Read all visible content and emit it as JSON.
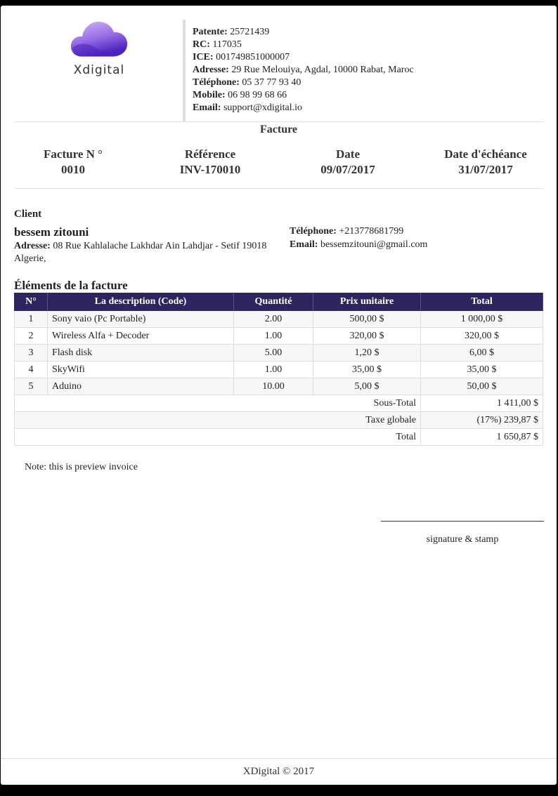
{
  "company": {
    "logo_text": "Xdigital",
    "patente_label": "Patente:",
    "patente": "25721439",
    "rc_label": "RC:",
    "rc": "117035",
    "ice_label": "ICE:",
    "ice": "001749851000007",
    "address_label": "Adresse:",
    "address": "29 Rue Melouiya, Agdal, 10000 Rabat, Maroc",
    "phone_label": "Téléphone:",
    "phone": "05 37 77 93 40",
    "mobile_label": "Mobile:",
    "mobile": "06 98 99 68 66",
    "email_label": "Email:",
    "email": "support@xdigital.io"
  },
  "title": "Facture",
  "meta": [
    {
      "label": "Facture N °",
      "value": "0010"
    },
    {
      "label": "Référence",
      "value": "INV-170010"
    },
    {
      "label": "Date",
      "value": "09/07/2017"
    },
    {
      "label": "Date d'échéance",
      "value": "31/07/2017"
    }
  ],
  "client": {
    "heading": "Client",
    "name": "bessem zitouni",
    "address_label": "Adresse:",
    "address": "08 Rue Kahlalache Lakhdar Ain Lahdjar - Setif 19018 Algerie,",
    "phone_label": "Téléphone:",
    "phone": "+213778681799",
    "email_label": "Email:",
    "email": "bessemzitouni@gmail.com"
  },
  "items_heading": "Éléments de la facture",
  "columns": [
    "N°",
    "La description (Code)",
    "Quantité",
    "Prix unitaire",
    "Total"
  ],
  "items": [
    {
      "no": "1",
      "desc": "Sony vaio (Pc Portable)",
      "qty": "2.00",
      "price": "500,00 $",
      "total": "1 000,00 $"
    },
    {
      "no": "2",
      "desc": "Wireless Alfa + Decoder",
      "qty": "1.00",
      "price": "320,00 $",
      "total": "320,00 $"
    },
    {
      "no": "3",
      "desc": "Flash disk",
      "qty": "5.00",
      "price": "1,20 $",
      "total": "6,00 $"
    },
    {
      "no": "4",
      "desc": "SkyWifi",
      "qty": "1.00",
      "price": "35,00 $",
      "total": "35,00 $"
    },
    {
      "no": "5",
      "desc": "Aduino",
      "qty": "10.00",
      "price": "5,00 $",
      "total": "50,00 $"
    }
  ],
  "totals": {
    "subtotal_label": "Sous-Total",
    "subtotal": "1 411,00 $",
    "tax_label": "Taxe globale",
    "tax": "(17%) 239,87 $",
    "total_label": "Total",
    "total": "1 650,87 $"
  },
  "note": "Note: this is preview invoice",
  "signature": "signature & stamp",
  "footer": "XDigital © 2017",
  "colors": {
    "header_bg": "#2c2560",
    "logo_top": "#c3a6f3",
    "logo_bottom": "#5b2fc9"
  }
}
